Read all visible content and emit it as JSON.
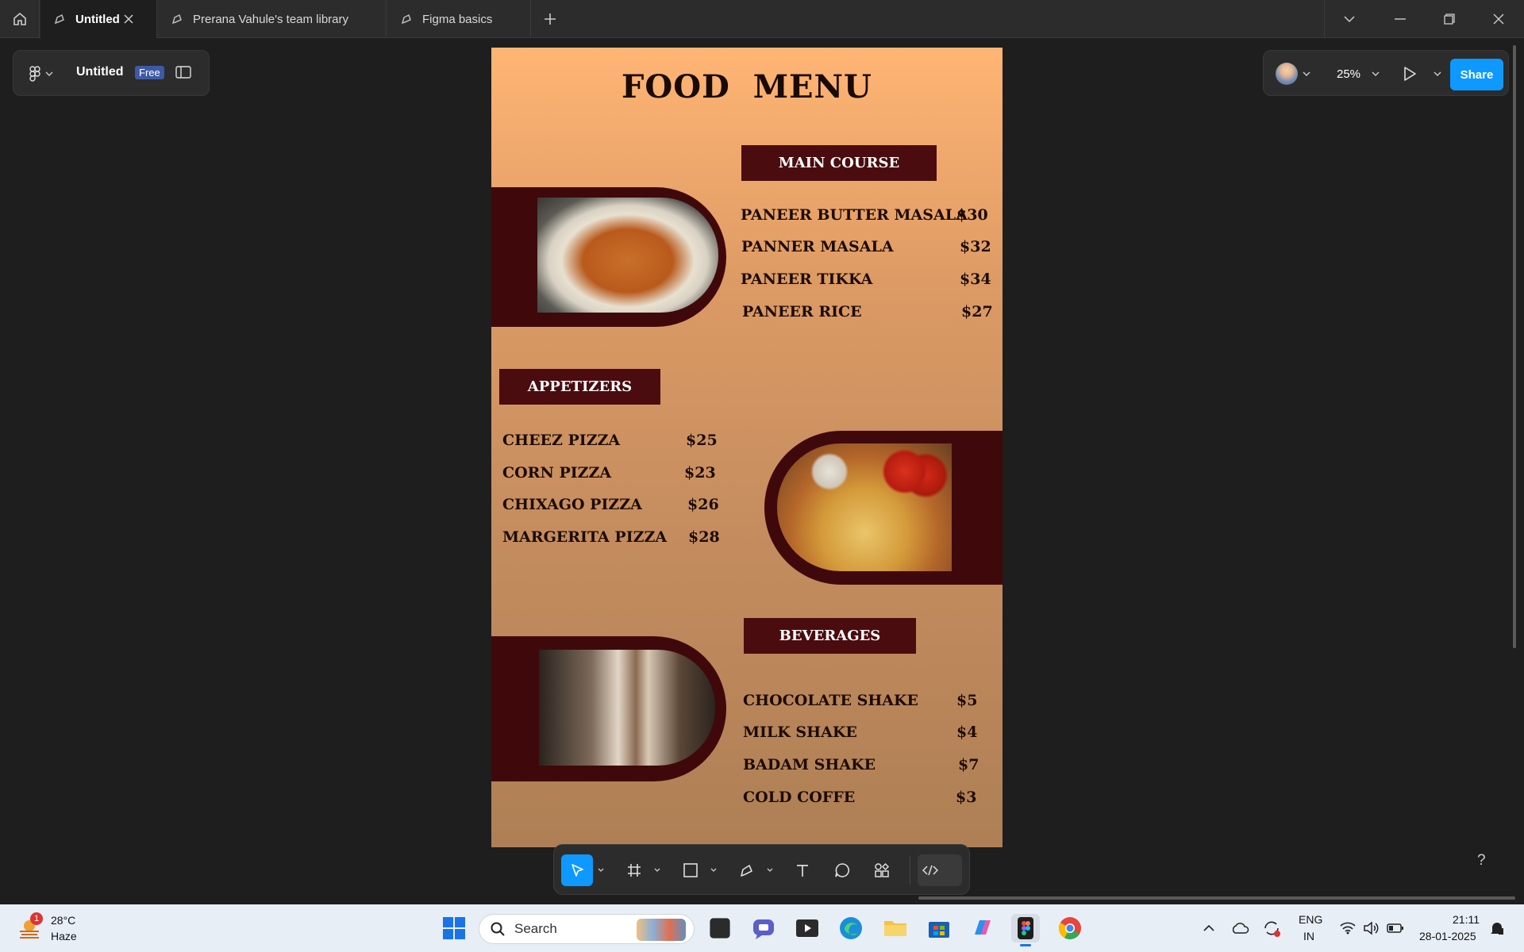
{
  "tabs": [
    {
      "label": "Untitled",
      "active": true
    },
    {
      "label": "Prerana Vahule's team library",
      "active": false
    },
    {
      "label": "Figma basics",
      "active": false
    }
  ],
  "file": {
    "name": "Untitled",
    "plan_badge": "Free"
  },
  "header": {
    "zoom": "25%",
    "share_label": "Share"
  },
  "menu": {
    "title": "FOOD  MENU",
    "sections": [
      {
        "label": "MAIN COURSE",
        "items": [
          {
            "name": "PANEER BUTTER MASALA",
            "price": "$30"
          },
          {
            "name": "PANNER MASALA",
            "price": "$32"
          },
          {
            "name": "PANEER TIKKA",
            "price": "$34"
          },
          {
            "name": "PANEER RICE",
            "price": "$27"
          }
        ]
      },
      {
        "label": "APPETIZERS",
        "items": [
          {
            "name": "CHEEZ PIZZA",
            "price": "$25"
          },
          {
            "name": "CORN PIZZA",
            "price": "$23"
          },
          {
            "name": "CHIXAGO PIZZA",
            "price": "$26"
          },
          {
            "name": "MARGERITA PIZZA",
            "price": "$28"
          }
        ]
      },
      {
        "label": "BEVERAGES",
        "items": [
          {
            "name": "CHOCOLATE SHAKE",
            "price": "$5"
          },
          {
            "name": "MILK SHAKE",
            "price": "$4"
          },
          {
            "name": "BADAM SHAKE",
            "price": "$7"
          },
          {
            "name": "COLD COFFE",
            "price": "$3"
          }
        ]
      }
    ]
  },
  "help_label": "?",
  "taskbar": {
    "weather_temp": "28°C",
    "weather_desc": "Haze",
    "weather_badge": "1",
    "search_placeholder": "Search",
    "lang_top": "ENG",
    "lang_bottom": "IN",
    "time": "21:11",
    "date": "28-01-2025"
  },
  "colors": {
    "accent": "#0d99ff",
    "menu_label_bg": "#4a0c0f",
    "blob": "#3f090c"
  }
}
